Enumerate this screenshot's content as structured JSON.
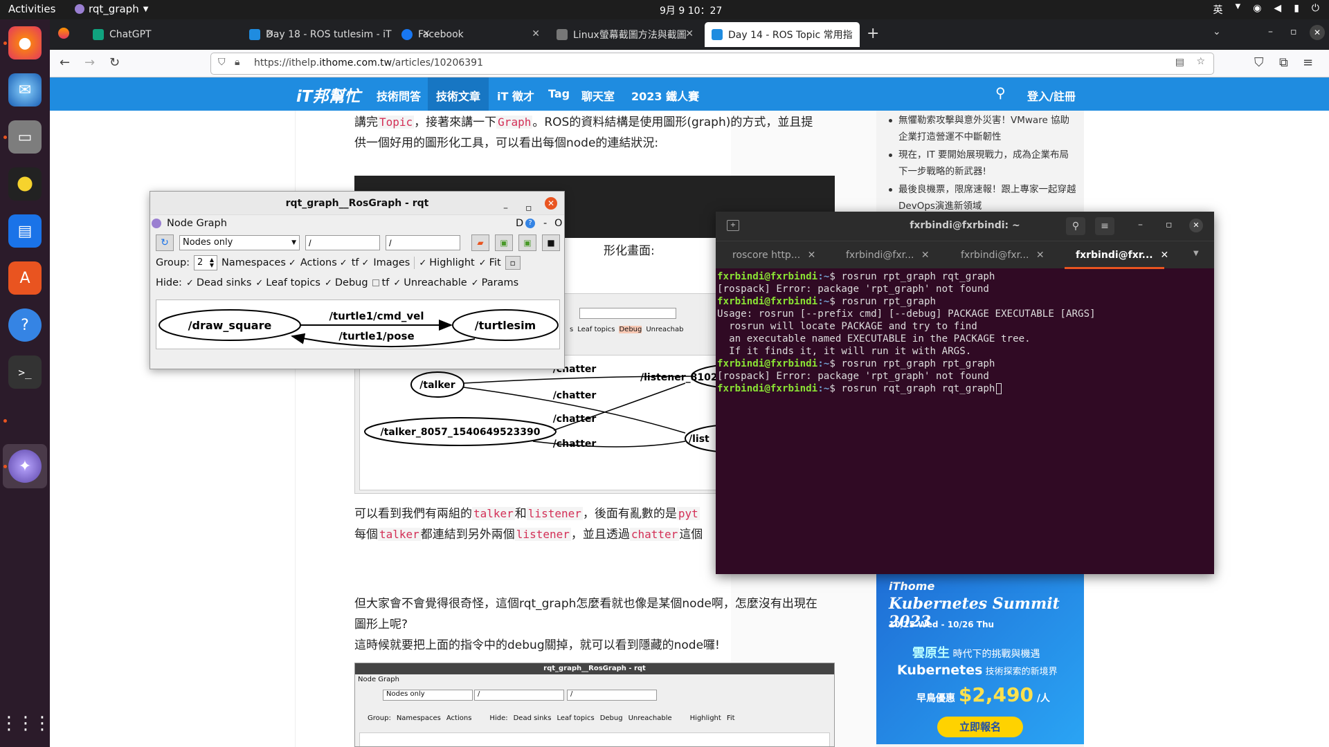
{
  "topbar": {
    "activities": "Activities",
    "app": "rqt_graph",
    "clock": "9月 9  10：27",
    "ime": "英"
  },
  "dock": {
    "items": [
      "firefox-icon",
      "thunderbird-icon",
      "files-icon",
      "rhythmbox-icon",
      "writer-icon",
      "software-icon",
      "help-icon",
      "terminal-icon",
      "rqt-icon",
      "apps-grid-icon"
    ]
  },
  "browser": {
    "tabs": [
      {
        "label": "ChatGPT",
        "color": "#10a37f"
      },
      {
        "label": "Day 18 - ROS tutlesim - iT",
        "color": "#1f8ce0"
      },
      {
        "label": "Facebook",
        "color": "#1877f2"
      },
      {
        "label": "Linux螢幕截圖方法與截圖",
        "color": "#777777"
      },
      {
        "label": "Day 14 - ROS Topic 常用指",
        "color": "#1f8ce0"
      }
    ],
    "url_prefix": "https://ithelp.",
    "url_domain": "ithome.com.tw",
    "url_path": "/articles/10206391"
  },
  "site": {
    "logo": "iT邦幫忙",
    "nav": [
      "技術問答",
      "技術文章",
      "iT 徵才",
      "Tag",
      "聊天室",
      "2023 鐵人賽"
    ],
    "login": "登入/註冊"
  },
  "article": {
    "p1a": "講完",
    "p1_code1": "Topic",
    "p1b": "，接著來講一下",
    "p1_code2": "Graph",
    "p1c": "。ROS的資料結構是使用圖形(graph)的方式，並且提",
    "p1_line2": "供一個好用的圖形化工具，可以看出每個node的連結狀況:",
    "p2_tail": "形化畫面:",
    "p3a": "可以看到我們有兩組的",
    "p3_code1": "talker",
    "p3b": "和",
    "p3_code2": "listener",
    "p3c": "，後面有亂數的是",
    "p3_code3": "pyt",
    "p4a": "每個",
    "p4_code1": "talker",
    "p4b": "都連結到另外兩個",
    "p4_code2": "listener",
    "p4c": "，並且透過",
    "p4_code3": "chatter",
    "p4d": "這個",
    "p5": "但大家會不會覺得很奇怪，這個rqt_graph怎麼看就也像是某個node啊，怎麼沒有出現在",
    "p5_line2": "圖形上呢?",
    "p6": "這時候就要把上面的指令中的debug關掉，就可以看到隱藏的node囉!"
  },
  "article_graph": {
    "nodes": [
      "/talker",
      "/listener_8102_",
      "/talker_8057_1540649523390",
      "/list"
    ],
    "edges": [
      "/chatter",
      "/chatter",
      "/chatter",
      "/chatter"
    ],
    "hide_opts": [
      "s",
      "Leaf topics",
      "Debug",
      "Unreachab"
    ]
  },
  "small_rqt": {
    "title": "rqt_graph__RosGraph - rqt",
    "node_graph": "Node Graph",
    "combo": "Nodes only",
    "f1": "/",
    "f2": "/",
    "row2": [
      "Namespaces",
      "Actions"
    ],
    "hide": "Hide:",
    "row2b": [
      "Dead sinks",
      "Leaf topics",
      "Debug",
      "Unreachable"
    ],
    "row2c": [
      "Highlight",
      "Fit"
    ],
    "group": "Group:"
  },
  "sidebar": {
    "news": [
      "無懼勒索攻擊與意外災害！VMware 協助企業打造營運不中斷韌性",
      "現在，IT 要開始展現戰力，成為企業布局下一步戰略的新武器!",
      "最後良機票，限席速報！跟上專家一起穿越DevOps演進新領域"
    ]
  },
  "ad": {
    "brand": "iThome",
    "title": "Kubernetes Summit 2023",
    "dates": "10/25 Wed - 10/26 Thu",
    "line1a": "雲原生",
    "line1b": "時代下的挑戰與機遇",
    "line2a": "Kubernetes",
    "line2b": "技術探索的新境界",
    "price_label": "早鳥優惠",
    "price": "$2,490",
    "unit": "/人",
    "cta": "立即報名"
  },
  "rqt": {
    "title": "rqt_graph__RosGraph - rqt",
    "plugin": "Node Graph",
    "plugin_right": "D",
    "combo": "Nodes only",
    "ns_filter": "/",
    "topic_filter": "/",
    "group_label": "Group:",
    "group_value": "2",
    "checks_row1": [
      {
        "label": "Namespaces",
        "checked": true
      },
      {
        "label": "Actions",
        "checked": true
      },
      {
        "label": "tf",
        "checked": true
      },
      {
        "label": "Images",
        "checked": true
      },
      {
        "label": "Highlight",
        "checked": true
      },
      {
        "label": "Fit",
        "checked": true
      }
    ],
    "hide_label": "Hide:",
    "checks_row2": [
      {
        "label": "Dead sinks",
        "checked": true
      },
      {
        "label": "Leaf topics",
        "checked": true
      },
      {
        "label": "Debug",
        "checked": true
      },
      {
        "label": "tf",
        "checked": false
      },
      {
        "label": "Unreachable",
        "checked": true
      },
      {
        "label": "Params",
        "checked": true
      }
    ],
    "graph": {
      "node_a": "/draw_square",
      "node_b": "/turtlesim",
      "edge_top": "/turtle1/cmd_vel",
      "edge_bottom": "/turtle1/pose"
    }
  },
  "terminal": {
    "title": "fxrbindi@fxrbindi: ~",
    "tabs": [
      "roscore http...",
      "fxrbindi@fxr...",
      "fxrbindi@fxr...",
      "fxrbindi@fxr..."
    ],
    "prompt_user": "fxrbindi@fxrbindi",
    "prompt_tail": ":~$ ",
    "lines": [
      {
        "type": "cmd",
        "text": "rosrun rpt_graph rqt_graph"
      },
      {
        "type": "out",
        "text": "[rospack] Error: package 'rpt_graph' not found"
      },
      {
        "type": "cmd",
        "text": "rosrun rpt_graph"
      },
      {
        "type": "out",
        "text": "Usage: rosrun [--prefix cmd] [--debug] PACKAGE EXECUTABLE [ARGS]"
      },
      {
        "type": "out",
        "text": "  rosrun will locate PACKAGE and try to find"
      },
      {
        "type": "out",
        "text": "  an executable named EXECUTABLE in the PACKAGE tree."
      },
      {
        "type": "out",
        "text": "  If it finds it, it will run it with ARGS."
      },
      {
        "type": "cmd",
        "text": "rosrun rpt_graph rpt_graph"
      },
      {
        "type": "out",
        "text": "[rospack] Error: package 'rpt_graph' not found"
      },
      {
        "type": "cmd",
        "text": "rosrun rqt_graph rqt_graph"
      }
    ]
  }
}
